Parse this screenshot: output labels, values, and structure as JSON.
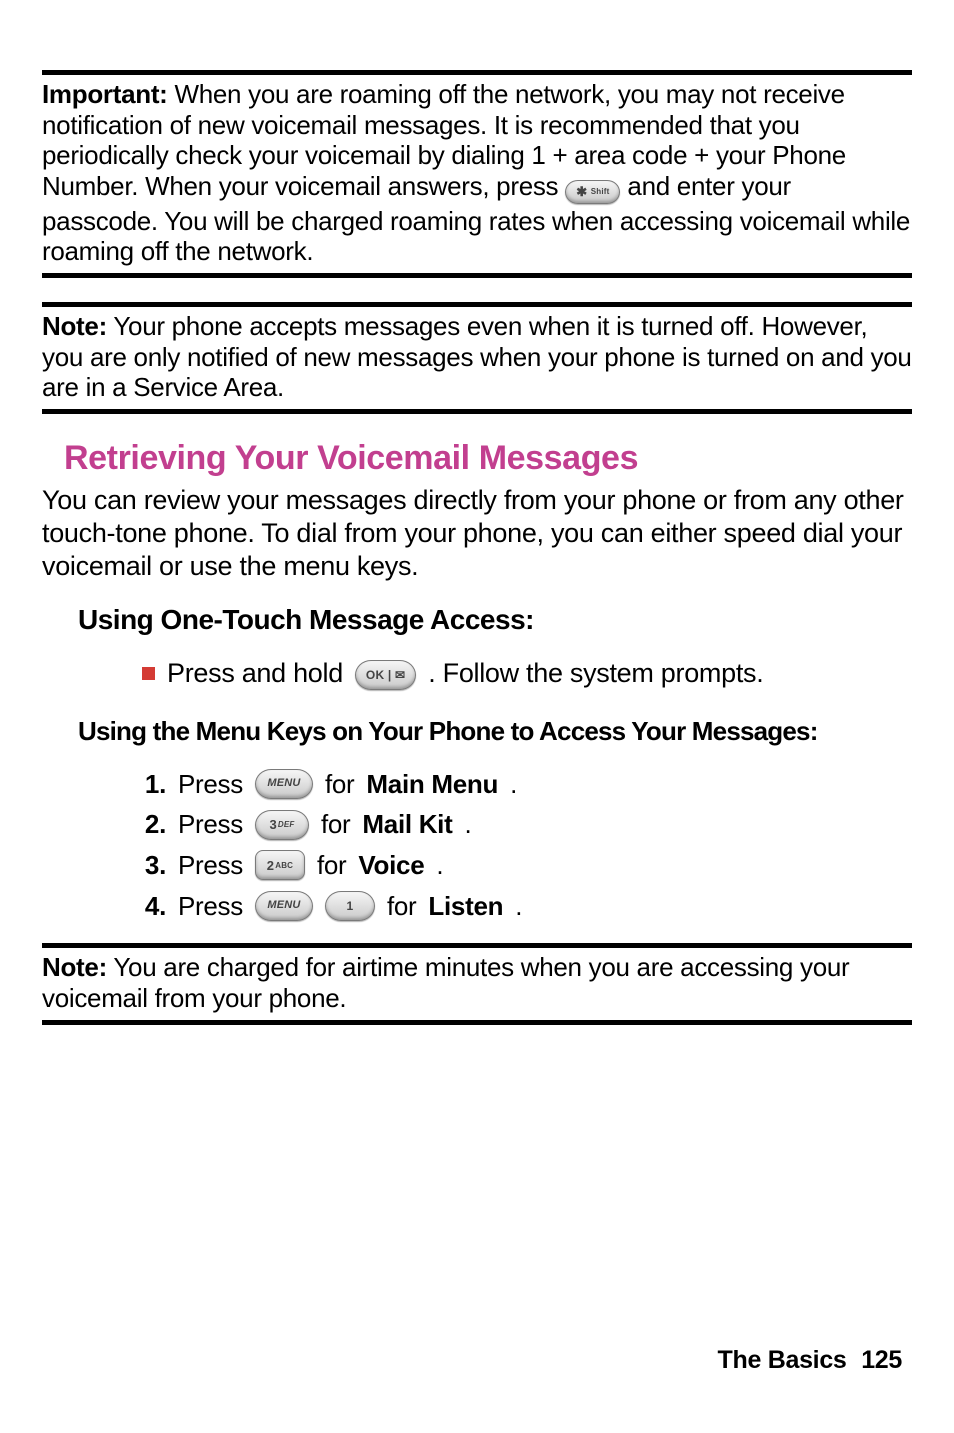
{
  "important": {
    "lead": "Important:",
    "text_a": " When you are roaming off the network, you may not receive notification of new voicemail messages. It is recommended that you periodically check your voicemail by dialing 1 + area code + your Phone Number. When your voicemail answers, press ",
    "key": "✱ Shift",
    "text_b": " and enter your passcode. You will be charged roaming rates when accessing voicemail while roaming off the network."
  },
  "note1": {
    "lead": "Note:",
    "text": " Your phone accepts messages even when it is turned off. However, you are only notified of new messages when your phone is turned on and you are in a Service Area."
  },
  "section_title": "Retrieving Your Voicemail Messages",
  "intro": "You can review your messages directly from your phone or from any other touch-tone phone. To dial from your phone, you can either speed dial your voicemail or use the menu keys.",
  "subhead1": "Using One-Touch Message Access:",
  "bullet": {
    "a": "Press and hold ",
    "key": "OK | ✉",
    "b": ". Follow the system prompts."
  },
  "subhead2": "Using the Menu Keys on Your Phone to Access Your Messages:",
  "steps": [
    {
      "num": "1.",
      "a": "Press ",
      "keys": [
        "MENU"
      ],
      "b": " for ",
      "target": "Main Menu",
      "c": "."
    },
    {
      "num": "2.",
      "a": "Press ",
      "keys": [
        "3 DEF"
      ],
      "b": " for ",
      "target": "Mail Kit",
      "c": "."
    },
    {
      "num": "3.",
      "a": "Press ",
      "keys": [
        "2 ABC"
      ],
      "b": " for ",
      "target": "Voice",
      "c": "."
    },
    {
      "num": "4.",
      "a": "Press ",
      "keys": [
        "MENU",
        "1"
      ],
      "b": " for ",
      "target": "Listen",
      "c": "."
    }
  ],
  "note2": {
    "lead": "Note:",
    "text": " You are charged for airtime minutes when you are accessing your voicemail from your phone."
  },
  "footer": {
    "section": "The Basics",
    "page": "125"
  },
  "keys": {
    "menu": "MENU",
    "ok": "OK",
    "one": "1",
    "two": "2 ABC",
    "three": "3 DEF",
    "star": "✱ Shift"
  }
}
